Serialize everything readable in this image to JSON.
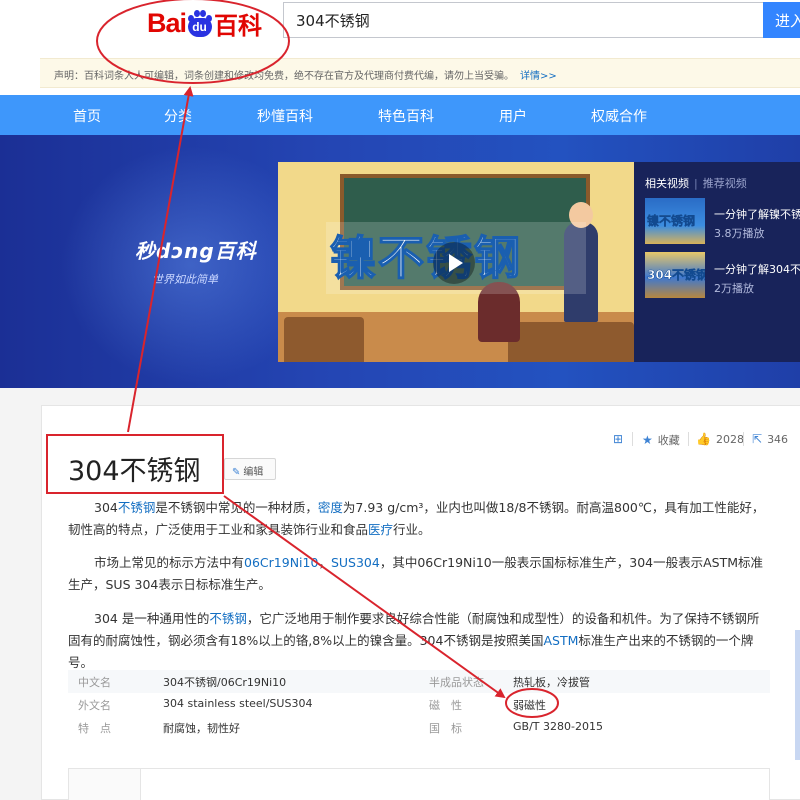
{
  "header": {
    "logo": {
      "part1": "Bai",
      "paw_text": "du",
      "part2": "百科"
    },
    "search": {
      "value": "304不锈钢",
      "placeholder": ""
    },
    "search_button": "进入"
  },
  "notice": {
    "text": "声明：百科词条人人可编辑，词条创建和修改均免费，绝不存在官方及代理商付费代编，请勿上当受骗。",
    "more_link": "详情>>"
  },
  "nav": {
    "items": [
      "首页",
      "分类",
      "秒懂百科",
      "特色百科",
      "用户",
      "权威合作"
    ]
  },
  "banner": {
    "brand": "秒dɔng百科",
    "slogan": "世界如此简单",
    "video_title": "镍不锈钢",
    "related_tabs": {
      "active": "相关视频",
      "inactive": "推荐视频"
    },
    "related_videos": [
      {
        "thumb_text": "镍不锈钢",
        "title": "一分钟了解镍不锈",
        "count": "3.8万播放"
      },
      {
        "thumb_text": "304不锈钢",
        "title": "一分钟了解304不...",
        "count": "2万播放"
      }
    ]
  },
  "actions": {
    "collect": "收藏",
    "like_count": "2028",
    "share_count": "346"
  },
  "article": {
    "title": "304不锈钢",
    "edit_label": "编辑",
    "p1": {
      "a": "304",
      "link1": "不锈钢",
      "b": "是不锈钢中常见的一种材质，",
      "link2": "密度",
      "c": "为7.93 g/cm³，业内也叫做18/8不锈钢。耐高温800℃，具有加工性能好，韧性高的特点，广泛使用于工业和家具装饰行业和食品",
      "link3": "医疗",
      "d": "行业。"
    },
    "p2": {
      "a": "市场上常见的标示方法中有",
      "link1": "06Cr19Ni10",
      "b": "，",
      "link2": "SUS304",
      "c": "，其中06Cr19Ni10一般表示国标标准生产，304一般表示ASTM标准生产，SUS 304表示日标标准生产。"
    },
    "p3": {
      "a": "304 是一种通用性的",
      "link1": "不锈钢",
      "b": "，它广泛地用于制作要求良好综合性能（耐腐蚀和成型性）的设备和机件。为了保持不锈钢所固有的耐腐蚀性，钢必须含有18%以上的铬,8%以上的镍含量。304不锈钢是按照美国",
      "link2": "ASTM",
      "c": "标准生产出来的不锈钢的一个牌号。"
    }
  },
  "infobox": {
    "rows": [
      {
        "k1": "中文名",
        "v1": "304不锈钢/06Cr19Ni10",
        "k2": "半成品状态",
        "v2": "热轧板，冷拔管"
      },
      {
        "k1": "外文名",
        "v1": "304 stainless steel/SUS304",
        "k2": "磁　性",
        "v2": "弱磁性"
      },
      {
        "k1": "特　点",
        "v1": "耐腐蚀，韧性好",
        "k2": "国　标",
        "v2": "GB/T 3280-2015"
      }
    ]
  },
  "colors": {
    "nav_blue": "#3e97fb",
    "link_blue": "#136ec2",
    "annotation_red": "#d9242d",
    "logo_red": "#e10602",
    "logo_blue": "#2932e1"
  }
}
